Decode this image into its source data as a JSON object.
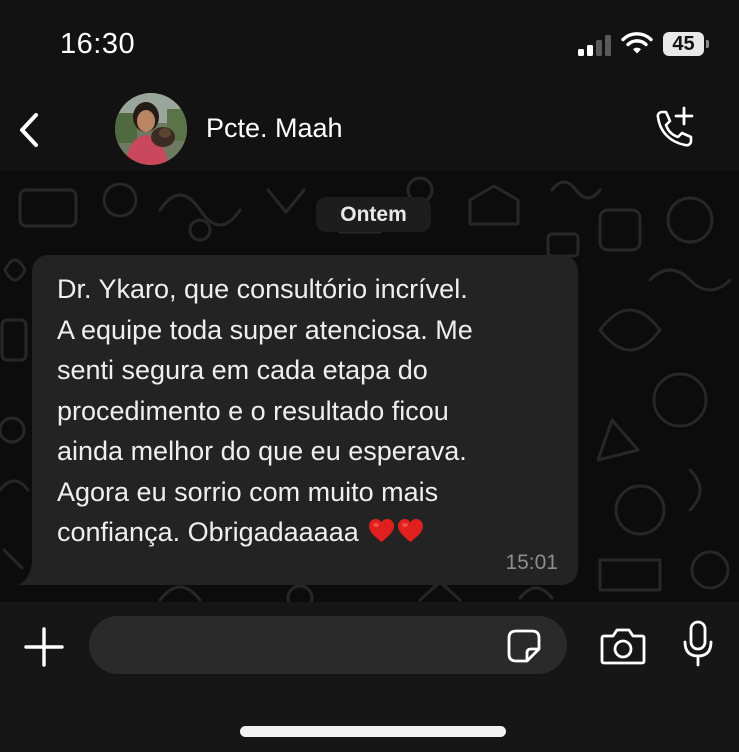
{
  "status_bar": {
    "time": "16:30",
    "battery_level": "45",
    "icons": [
      "signal-icon",
      "wifi-icon",
      "battery-icon"
    ]
  },
  "header": {
    "contact_name": "Pcte. Maah",
    "icons": [
      "back-icon",
      "contact-avatar",
      "add-call-icon"
    ]
  },
  "chat": {
    "date_label": "Ontem",
    "message": {
      "text": "Dr. Ykaro, que consultório incrível.\nA equipe toda super atenciosa. Me\nsenti segura em cada etapa do\nprocedimento e o resultado ficou\nainda melhor do que eu esperava.\nAgora eu sorrio com muito mais\nconfiança. Obrigadaaaaa",
      "emoji": "❤️❤️",
      "time": "15:01"
    }
  },
  "composer": {
    "icons": [
      "plus-icon",
      "sticker-icon",
      "camera-icon",
      "microphone-icon"
    ]
  },
  "colors": {
    "background": "#0b0b0b",
    "bars": "#121212",
    "bubble": "#232323",
    "input": "#2a2a2a",
    "text": "#efefef",
    "muted": "#8d8d8d",
    "heart": "#e0201f"
  }
}
